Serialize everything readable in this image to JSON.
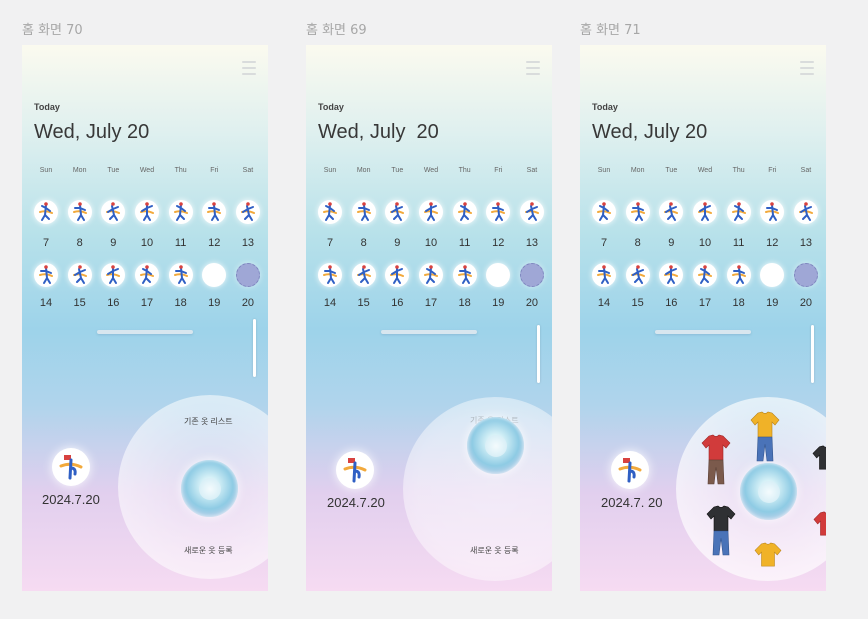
{
  "screens": [
    {
      "label": "홈 화면 70",
      "today_label": "Today",
      "date_title": "Wed, July 20",
      "date_stamp": "2024.7.20",
      "existing_list_label": "기존 옷 리스트",
      "register_new_label": "새로운 옷 등록"
    },
    {
      "label": "홈 화면 69",
      "today_label": "Today",
      "date_title": "Wed, July  20",
      "date_stamp": "2024.7.20",
      "existing_list_label": "기존 옷 리스트",
      "register_new_label": "새로운 옷 등록"
    },
    {
      "label": "홈 화면 71",
      "today_label": "Today",
      "date_title": "Wed, July 20",
      "date_stamp": "2024.7. 20"
    }
  ],
  "weekdays": [
    "Sun",
    "Mon",
    "Tue",
    "Wed",
    "Thu",
    "Fri",
    "Sat"
  ],
  "week1_days": [
    "7",
    "8",
    "9",
    "10",
    "11",
    "12",
    "13"
  ],
  "week2_days": [
    "14",
    "15",
    "16",
    "17",
    "18",
    "19",
    "20"
  ],
  "week1_state": [
    "outfit-icon",
    "outfit-icon",
    "outfit-icon",
    "outfit-icon",
    "outfit-icon",
    "outfit-icon",
    "outfit-icon"
  ],
  "week2_state": [
    "outfit-icon",
    "outfit-icon",
    "outfit-icon",
    "outfit-icon",
    "outfit-icon",
    "empty",
    "selected"
  ],
  "clothing_icons": [
    "red-shirt-icon",
    "yellow-shirt-icon",
    "black-shirt-icon",
    "red-shirt-icon",
    "yellow-shirt-icon",
    "black-shirt-icon"
  ],
  "colors": {
    "accent_blue": "#2f5fc4",
    "accent_orange": "#f2a93b",
    "accent_red": "#d8423f",
    "shirt_red": "#d13b3b",
    "shirt_yellow": "#f0b228",
    "shirt_black": "#2f3033",
    "pants_blue": "#4a73b8",
    "pants_brown": "#7b5a4c"
  }
}
